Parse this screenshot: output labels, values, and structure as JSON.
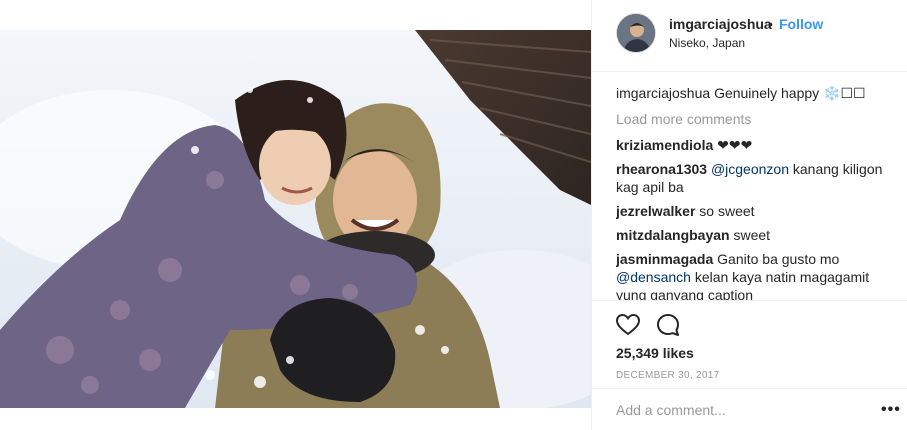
{
  "post": {
    "username": "imgarciajoshua",
    "separator": "•",
    "follow_label": "Follow",
    "location": "Niseko, Japan",
    "avatar_icon": "profile-avatar",
    "photo_icon": "post-photo"
  },
  "caption": {
    "username": "imgarciajoshua",
    "text": "Genuinely happy ❄️☐☐"
  },
  "load_more_label": "Load more comments",
  "comments": [
    {
      "username": "kriziamendiola",
      "text": "❤❤❤"
    },
    {
      "username": "rhearona1303",
      "mention": "@jcgeonzon",
      "text": "kanang kiligon kag apil ba"
    },
    {
      "username": "jezrelwalker",
      "text": "so sweet"
    },
    {
      "username": "mitzdalangbayan",
      "text": "sweet"
    },
    {
      "username": "jasminmagada",
      "text": "Ganito ba gusto mo",
      "mention": "@densanch",
      "text2": "kelan kaya natin magagamit yung ganyang caption"
    }
  ],
  "actions": {
    "like_icon": "heart-icon",
    "comment_icon": "comment-bubble-icon"
  },
  "likes": "25,349 likes",
  "date": "DECEMBER 30, 2017",
  "add_comment": {
    "placeholder": "Add a comment...",
    "more_label": "•••"
  },
  "colors": {
    "link_blue": "#3897f0",
    "muted_gray": "#999999",
    "text": "#262626",
    "mention": "#003569"
  }
}
